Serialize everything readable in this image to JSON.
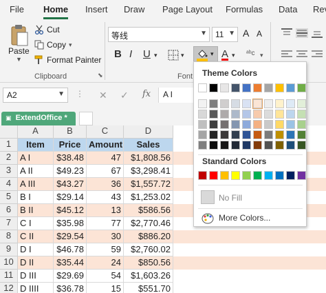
{
  "tabs": [
    "File",
    "Home",
    "Insert",
    "Draw",
    "Page Layout",
    "Formulas",
    "Data",
    "Rev"
  ],
  "clipboard": {
    "paste": "Paste",
    "cut": "Cut",
    "copy": "Copy",
    "format_painter": "Format Painter",
    "group_label": "Clipboard"
  },
  "font": {
    "name": "等线",
    "size": "11",
    "bold": "B",
    "italic": "I",
    "underline": "U",
    "grow": "A",
    "shrink": "A",
    "group_label": "Font"
  },
  "formula_bar": {
    "name_box": "A2",
    "fx": "fx",
    "content": "A I"
  },
  "workbook_tab": "ExtendOffice *",
  "columns": [
    "A",
    "B",
    "C",
    "D"
  ],
  "rows": [
    "1",
    "2",
    "3",
    "4",
    "5",
    "6",
    "7",
    "8",
    "9",
    "10",
    "11",
    "12"
  ],
  "table": {
    "headers": [
      "Item",
      "Price",
      "Amount",
      "Sales"
    ],
    "rows": [
      [
        "A I",
        "$38.48",
        "47",
        "$1,808.56"
      ],
      [
        "A II",
        "$49.23",
        "67",
        "$3,298.41"
      ],
      [
        "A III",
        "$43.27",
        "36",
        "$1,557.72"
      ],
      [
        "B I",
        "$29.14",
        "43",
        "$1,253.02"
      ],
      [
        "B II",
        "$45.12",
        "13",
        "$586.56"
      ],
      [
        "C I",
        "$35.98",
        "77",
        "$2,770.46"
      ],
      [
        "C II",
        "$29.54",
        "30",
        "$886.20"
      ],
      [
        "D I",
        "$46.78",
        "59",
        "$2,760.02"
      ],
      [
        "D II",
        "$35.44",
        "24",
        "$850.56"
      ],
      [
        "D III",
        "$29.69",
        "54",
        "$1,603.26"
      ],
      [
        "D IIII",
        "$36.78",
        "15",
        "$551.70"
      ]
    ]
  },
  "popup": {
    "theme_title": "Theme Colors",
    "standard_title": "Standard Colors",
    "no_fill": "No Fill",
    "more_colors": "More Colors...",
    "theme_top": [
      "#ffffff",
      "#000000",
      "#e7e6e6",
      "#44546a",
      "#4472c4",
      "#ed7d31",
      "#a5a5a5",
      "#ffc000",
      "#5b9bd5",
      "#70ad47"
    ],
    "theme_shades": [
      [
        "#f2f2f2",
        "#7f7f7f",
        "#d0cece",
        "#d6dce4",
        "#d9e2f3",
        "#fbe5d5",
        "#ededed",
        "#fff2cc",
        "#deeaf6",
        "#e2efd9"
      ],
      [
        "#d8d8d8",
        "#595959",
        "#aeaaaa",
        "#adb9ca",
        "#b4c6e7",
        "#f7cbac",
        "#dbdbdb",
        "#ffe599",
        "#bdd6ee",
        "#c5e0b3"
      ],
      [
        "#bfbfbf",
        "#3f3f3f",
        "#757070",
        "#8496b0",
        "#8eaadb",
        "#f4b183",
        "#c9c9c9",
        "#ffd966",
        "#9cc3e5",
        "#a8d08d"
      ],
      [
        "#a5a5a5",
        "#262626",
        "#3a3838",
        "#323f4f",
        "#2f5496",
        "#c55a11",
        "#7b7b7b",
        "#bf9000",
        "#2e75b5",
        "#538135"
      ],
      [
        "#7f7f7f",
        "#0c0c0c",
        "#171616",
        "#222a35",
        "#1f3864",
        "#833c0b",
        "#525252",
        "#7f6000",
        "#1e4e79",
        "#375623"
      ]
    ],
    "standard": [
      "#c00000",
      "#ff0000",
      "#ffc000",
      "#ffff00",
      "#92d050",
      "#00b050",
      "#00b0f0",
      "#0070c0",
      "#002060",
      "#7030a0"
    ]
  },
  "colors": {
    "accent": "#217346",
    "header_fill": "#bdd7ee",
    "band_fill": "#fce4d6",
    "workbook_tab": "#4fa77a"
  }
}
